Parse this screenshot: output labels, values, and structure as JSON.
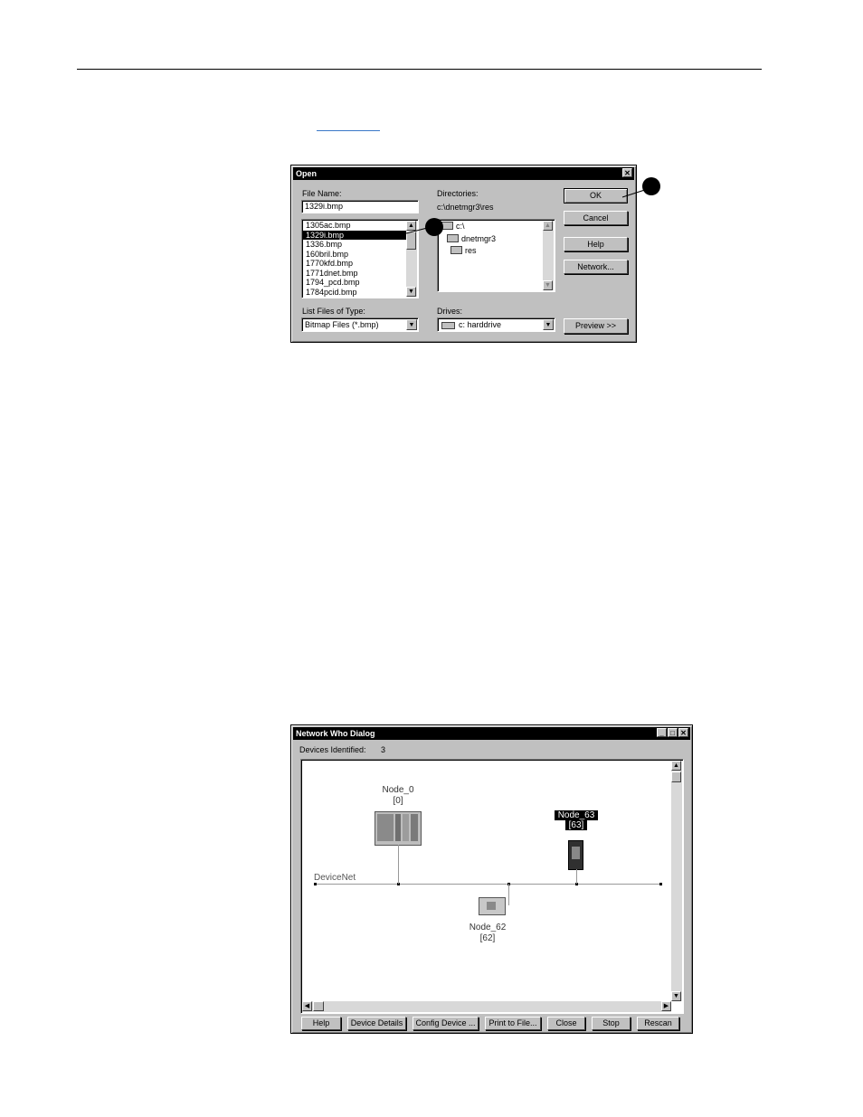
{
  "open_dialog": {
    "title": "Open",
    "close_glyph": "✕",
    "file_name_label": "File Name:",
    "file_name_value": "1329i.bmp",
    "files": [
      "1305ac.bmp",
      "1329i.bmp",
      "1336.bmp",
      "160bril.bmp",
      "1770kfd.bmp",
      "1771dnet.bmp",
      "1794_pcd.bmp",
      "1784pcid.bmp"
    ],
    "selected_file_index": 1,
    "directories_label": "Directories:",
    "current_dir": "c:\\dnetmgr3\\res",
    "dir_tree": [
      "c:\\",
      "dnetmgr3",
      "res"
    ],
    "list_type_label": "List Files of Type:",
    "list_type_value": "Bitmap Files (*.bmp)",
    "drives_label": "Drives:",
    "drive_value": "c: harddrive",
    "buttons": {
      "ok": "OK",
      "cancel": "Cancel",
      "help": "Help",
      "network": "Network...",
      "preview": "Preview >>"
    }
  },
  "who_dialog": {
    "title": "Network Who Dialog",
    "devices_identified_label": "Devices Identified:",
    "devices_identified_count": "3",
    "network_label": "DeviceNet",
    "nodes": [
      {
        "name": "Node_0",
        "address": "[0]"
      },
      {
        "name": "Node_63",
        "address": "[63]"
      },
      {
        "name": "Node_62",
        "address": "[62]"
      }
    ],
    "buttons": [
      "Help",
      "Device Details",
      "Config Device ...",
      "Print to File...",
      "Close",
      "Stop",
      "Rescan"
    ]
  },
  "colors": {
    "link_blue": "#3a78c8",
    "dialog_gray": "#c0c0c0",
    "title_bar": "#000000"
  }
}
